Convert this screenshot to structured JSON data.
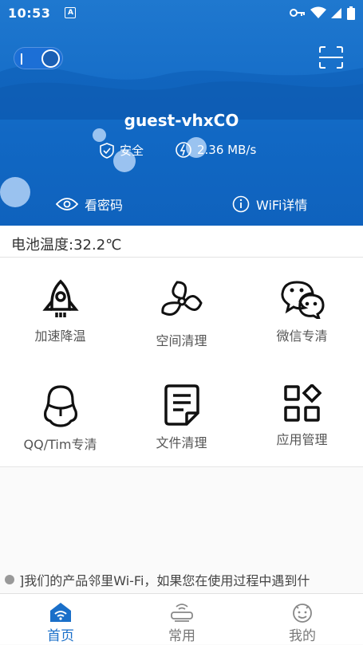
{
  "status_bar": {
    "time": "10:53",
    "notification_icon": "A"
  },
  "wifi": {
    "ssid": "guest-vhxCO",
    "security_label": "安全",
    "speed": "2.36 MB/s"
  },
  "actions": {
    "view_password": "看密码",
    "wifi_details": "WiFi详情"
  },
  "battery_temp": "电池温度:32.2℃",
  "tools": [
    {
      "label": "加速降温",
      "icon": "rocket-icon"
    },
    {
      "label": "空间清理",
      "icon": "fan-icon"
    },
    {
      "label": "微信专清",
      "icon": "wechat-icon"
    },
    {
      "label": "QQ/Tim专清",
      "icon": "qq-penguin-icon"
    },
    {
      "label": "文件清理",
      "icon": "document-icon"
    },
    {
      "label": "应用管理",
      "icon": "apps-grid-icon"
    }
  ],
  "marquee_text": "]我们的产品邻里Wi-Fi，如果您在使用过程中遇到什",
  "tabs": [
    {
      "label": "首页",
      "icon": "home-wifi-icon",
      "active": true
    },
    {
      "label": "常用",
      "icon": "router-icon",
      "active": false
    },
    {
      "label": "我的",
      "icon": "smiley-icon",
      "active": false
    }
  ],
  "colors": {
    "primary": "#1168c4",
    "active_tab": "#1a6fc9"
  }
}
